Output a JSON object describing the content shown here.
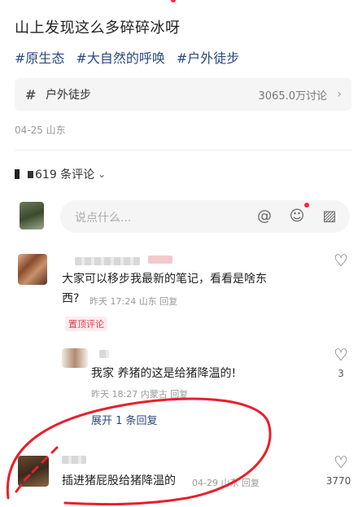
{
  "post": {
    "title": "山上发现这么多碎碎冰呀",
    "tags": [
      "#原生态",
      "#大自然的呼唤",
      "#户外徒步"
    ],
    "date": "04-25 山东"
  },
  "topic": {
    "hash": "#",
    "name": "户外徒步",
    "count": "3065.0万讨论",
    "chevron": "›"
  },
  "comments_header": {
    "count_label": "619 条评论",
    "chevron": "⌄"
  },
  "composer": {
    "placeholder": "说点什么...",
    "icons": [
      "at-icon",
      "emoji-icon",
      "image-icon"
    ],
    "at_glyph": "@",
    "emoji_glyph": "☺",
    "image_glyph": "▨"
  },
  "comments": [
    {
      "text_line1": "大家可以移步我最新的笔记，看看是啥东",
      "text_line2": "西?",
      "meta": "昨天 17:24 山东 回复",
      "pinned_label": "置顶评论",
      "heart": "♡"
    },
    {
      "text": "我家 养猪的这是给猪降温的!",
      "meta": "昨天 18:27 内蒙古 回复",
      "heart": "♡",
      "likes": "3"
    },
    {
      "text": "插进猪屁股给猪降温的",
      "meta": "04-29 山东 回复",
      "heart": "♡",
      "likes": "3770"
    }
  ],
  "expand_replies": "展开 1 条回复",
  "colors": {
    "accent_red": "#ff2442",
    "tag_blue": "#2a4a7f",
    "annotation_red": "#e8202a"
  }
}
